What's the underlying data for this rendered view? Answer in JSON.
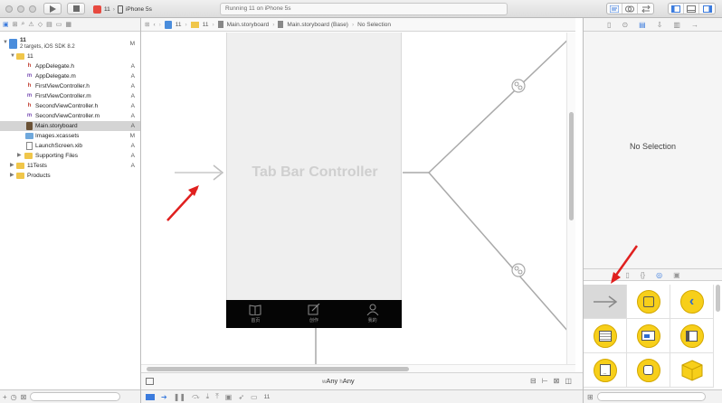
{
  "toolbar": {
    "scheme_name": "11",
    "device": "iPhone 5s",
    "activity_text": "Running 11 on iPhone 5s"
  },
  "navigator": {
    "items": [
      {
        "name": "11",
        "status": "M",
        "depth": 0,
        "kind": "project",
        "subtitle": "2 targets, iOS SDK 8.2"
      },
      {
        "name": "11",
        "status": "",
        "depth": 1,
        "kind": "group"
      },
      {
        "name": "AppDelegate.h",
        "status": "A",
        "depth": 2,
        "kind": "h"
      },
      {
        "name": "AppDelegate.m",
        "status": "A",
        "depth": 2,
        "kind": "m"
      },
      {
        "name": "FirstViewController.h",
        "status": "A",
        "depth": 2,
        "kind": "h"
      },
      {
        "name": "FirstViewController.m",
        "status": "A",
        "depth": 2,
        "kind": "m"
      },
      {
        "name": "SecondViewController.h",
        "status": "A",
        "depth": 2,
        "kind": "h"
      },
      {
        "name": "SecondViewController.m",
        "status": "A",
        "depth": 2,
        "kind": "m"
      },
      {
        "name": "Main.storyboard",
        "status": "A",
        "depth": 2,
        "kind": "storyboard",
        "selected": true
      },
      {
        "name": "Images.xcassets",
        "status": "M",
        "depth": 2,
        "kind": "assets"
      },
      {
        "name": "LaunchScreen.xib",
        "status": "A",
        "depth": 2,
        "kind": "xib"
      },
      {
        "name": "Supporting Files",
        "status": "A",
        "depth": 2,
        "kind": "group"
      },
      {
        "name": "11Tests",
        "status": "A",
        "depth": 1,
        "kind": "group"
      },
      {
        "name": "Products",
        "status": "",
        "depth": 1,
        "kind": "group"
      }
    ]
  },
  "jumpbar": {
    "crumbs": [
      "11",
      "11",
      "Main.storyboard",
      "Main.storyboard (Base)",
      "No Selection"
    ]
  },
  "canvas": {
    "controller_title": "Tab Bar Controller",
    "tabs": [
      {
        "label": "首页",
        "icon": "book-icon"
      },
      {
        "label": "创作",
        "icon": "compose-icon"
      },
      {
        "label": "我的",
        "icon": "person-icon"
      }
    ],
    "size_class_any_w": "Any",
    "size_class_any_h": "Any",
    "w_prefix": "w",
    "h_prefix": "h"
  },
  "inspector": {
    "no_selection": "No Selection"
  },
  "debug_bar": {
    "target": "11"
  },
  "colors": {
    "accent": "#3b7bdd",
    "annotation_arrow": "#e0201f",
    "object_yellow": "#f7cf1a",
    "tab_bar_bg": "#050505",
    "controller_bg": "#efefef"
  }
}
